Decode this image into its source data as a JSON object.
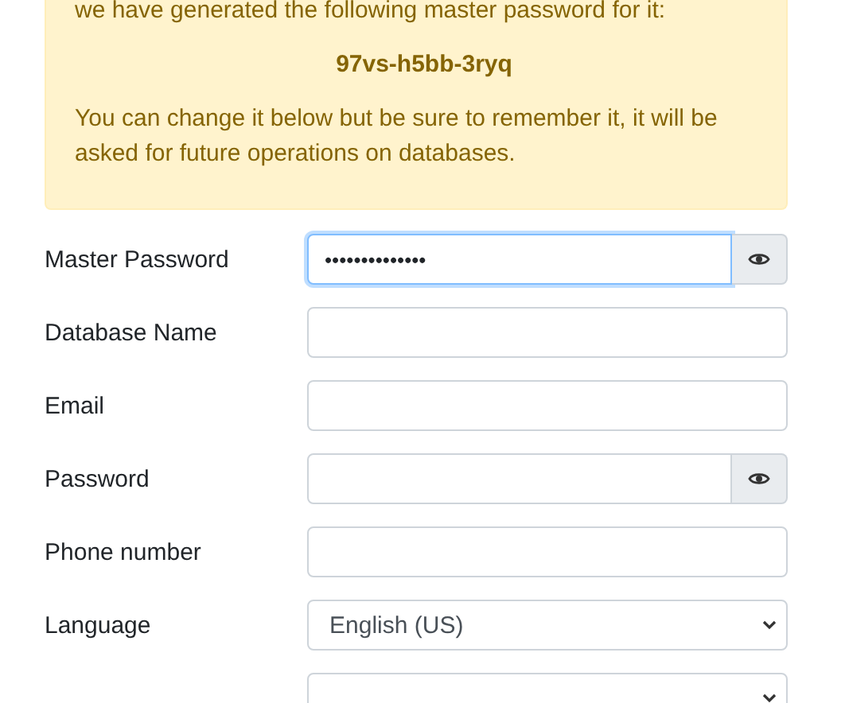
{
  "alert": {
    "intro": "we have generated the following master password for it:",
    "generated_password": "97vs-h5bb-3ryq",
    "note": "You can change it below but be sure to remember it, it will be asked for future operations on databases."
  },
  "fields": [
    {
      "kind": "password",
      "label": "Master Password",
      "value": "••••••••••••••",
      "focused": true
    },
    {
      "kind": "text",
      "label": "Database Name",
      "focused": false
    },
    {
      "kind": "text",
      "label": "Email",
      "focused": false
    },
    {
      "kind": "password",
      "label": "Password",
      "focused": false
    },
    {
      "kind": "text",
      "label": "Phone number",
      "focused": false
    },
    {
      "kind": "select",
      "label": "Language",
      "value": "English (US)",
      "focused": false
    },
    {
      "kind": "select",
      "focused": false
    }
  ]
}
